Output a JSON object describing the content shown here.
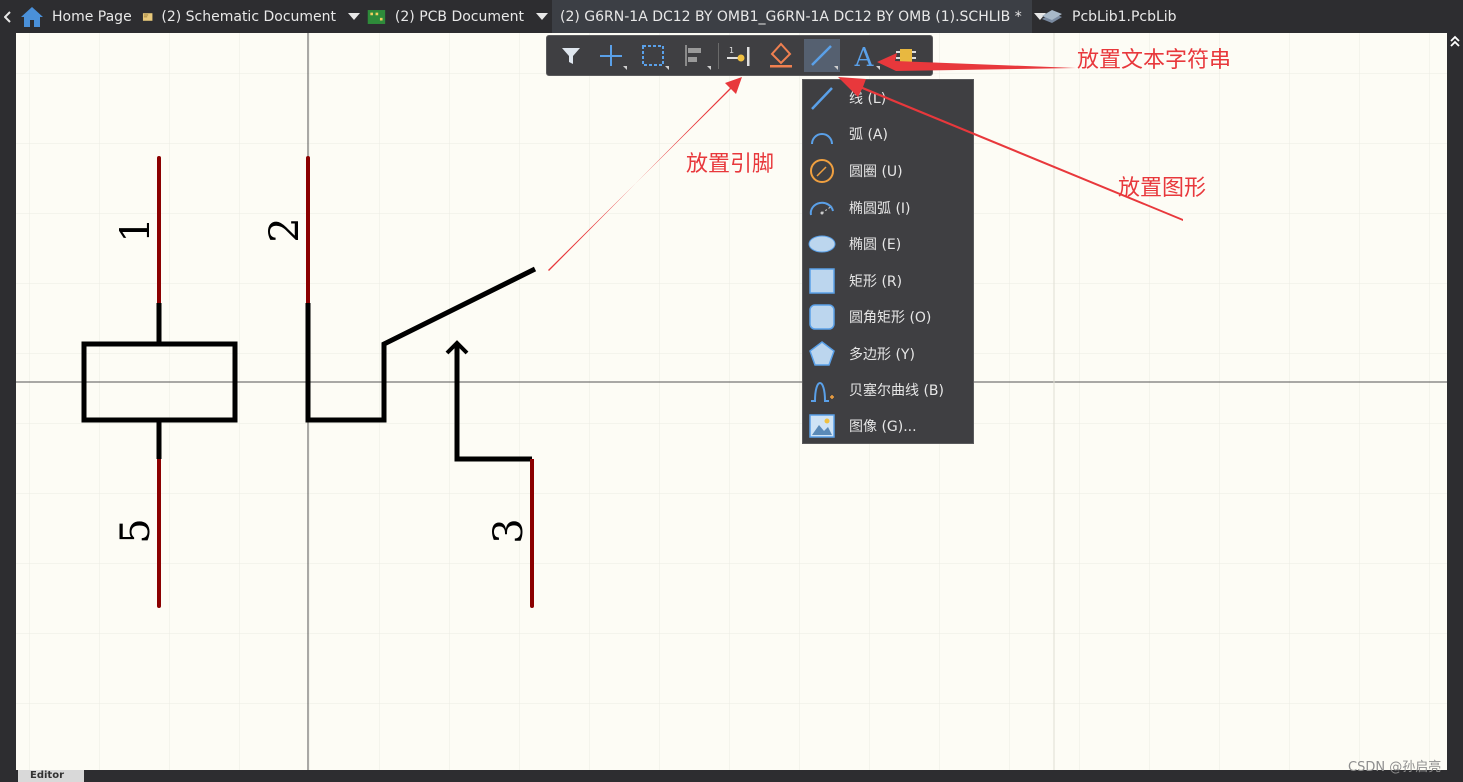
{
  "tabs": [
    {
      "label": "Home Page",
      "icon": "home-icon"
    },
    {
      "label": "(2) Schematic Document",
      "icon": "schematic-doc-icon"
    },
    {
      "label": "(2) PCB Document",
      "icon": "pcb-doc-icon"
    },
    {
      "label": "(2) G6RN-1A DC12 BY OMB1_G6RN-1A DC12 BY OMB (1).SCHLIB *",
      "icon": "schlib-icon"
    },
    {
      "label": "PcbLib1.PcbLib",
      "icon": "pcblib-icon"
    }
  ],
  "toolbar": {
    "buttons": [
      {
        "name": "filter",
        "icon": "filter-icon"
      },
      {
        "name": "move",
        "icon": "move-cross-icon"
      },
      {
        "name": "select",
        "icon": "selection-rect-icon"
      },
      {
        "name": "align",
        "icon": "align-icon"
      },
      {
        "name": "place-pin",
        "icon": "pin-icon"
      },
      {
        "name": "place-ieee",
        "icon": "ieee-symbol-icon"
      },
      {
        "name": "place-line",
        "icon": "line-icon"
      },
      {
        "name": "place-text",
        "icon": "text-a-icon",
        "glyph": "A"
      },
      {
        "name": "place-component",
        "icon": "component-icon"
      }
    ]
  },
  "dropdown": {
    "items": [
      {
        "label": "线 (L)",
        "icon": "line-icon"
      },
      {
        "label": "弧 (A)",
        "icon": "arc-icon"
      },
      {
        "label": "圆圈 (U)",
        "icon": "circle-icon"
      },
      {
        "label": "椭圆弧 (I)",
        "icon": "elliptical-arc-icon"
      },
      {
        "label": "椭圆 (E)",
        "icon": "ellipse-icon"
      },
      {
        "label": "矩形 (R)",
        "icon": "rectangle-icon"
      },
      {
        "label": "圆角矩形 (O)",
        "icon": "round-rectangle-icon"
      },
      {
        "label": "多边形 (Y)",
        "icon": "polygon-icon"
      },
      {
        "label": "贝塞尔曲线 (B)",
        "icon": "bezier-icon"
      },
      {
        "label": "图像 (G)...",
        "icon": "image-icon"
      }
    ]
  },
  "annotations": {
    "place_text": "放置文本字符串",
    "place_pin": "放置引脚",
    "place_graphic": "放置图形"
  },
  "schematic": {
    "pins": [
      "1",
      "2",
      "5",
      "3"
    ]
  },
  "bottom_tab": "Editor",
  "watermark": "CSDN @孙启亮",
  "colors": {
    "pin": "#8b0000",
    "body_line": "#000000",
    "annotation": "#e8383c",
    "canvas": "#fdfcf5",
    "grid": "#eceae0"
  }
}
